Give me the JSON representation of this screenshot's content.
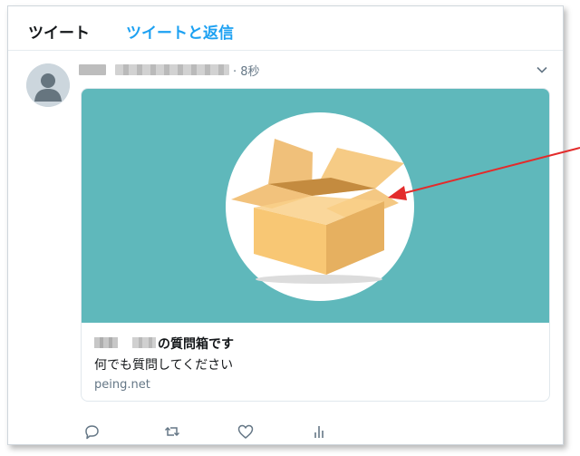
{
  "tabs": [
    {
      "label": "ツイート",
      "active": true
    },
    {
      "label": "ツイートと返信",
      "active": false
    }
  ],
  "tweet": {
    "time": "· 8秒",
    "card": {
      "title": "の質問箱です",
      "description": "何でも質問してください",
      "domain": "peing.net"
    },
    "actions": [
      "reply-icon",
      "retweet-icon",
      "like-icon",
      "analytics-icon"
    ]
  },
  "colors": {
    "accent": "#1da1f2",
    "card_image_bg": "#5fb8bb",
    "annotation_arrow": "#e32b2b"
  }
}
